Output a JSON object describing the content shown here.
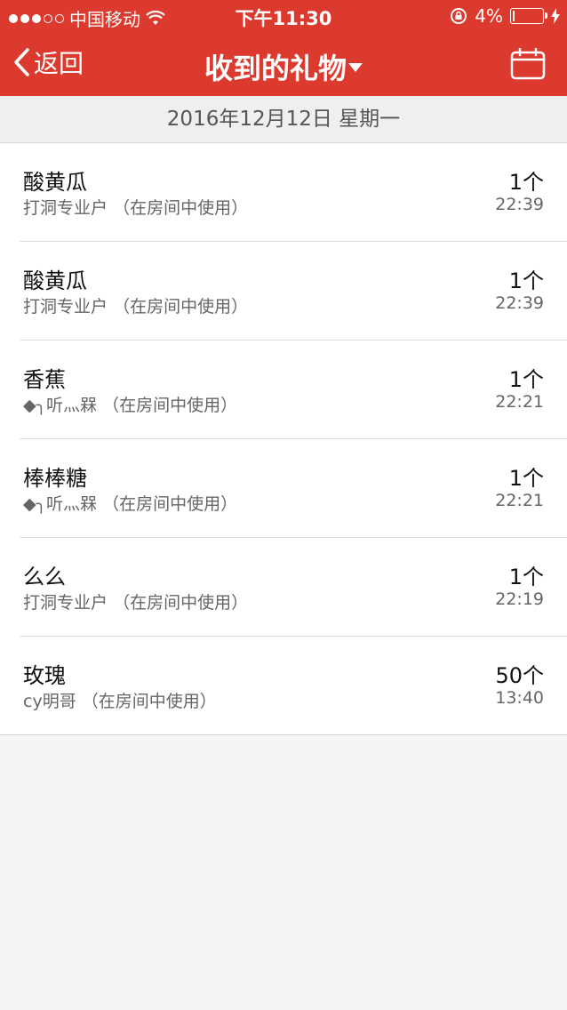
{
  "status_bar": {
    "carrier": "中国移动",
    "time": "下午11:30",
    "battery": "4%",
    "signal_bars_filled": 3,
    "signal_bars_total": 5
  },
  "nav": {
    "back_label": "返回",
    "title": "收到的礼物",
    "icons": [
      "chevron-left-icon",
      "caret-down-icon",
      "calendar-icon"
    ]
  },
  "date_header": "2016年12月12日 星期一",
  "gifts": [
    {
      "name": "酸黄瓜",
      "sender": "打洞专业户",
      "note": "（在房间中使用）",
      "count": "1个",
      "time": "22:39"
    },
    {
      "name": "酸黄瓜",
      "sender": "打洞专业户",
      "note": "（在房间中使用）",
      "count": "1个",
      "time": "22:39"
    },
    {
      "name": "香蕉",
      "sender": "◆╮听灬槑",
      "note": "（在房间中使用）",
      "count": "1个",
      "time": "22:21"
    },
    {
      "name": "棒棒糖",
      "sender": "◆╮听灬槑",
      "note": "（在房间中使用）",
      "count": "1个",
      "time": "22:21"
    },
    {
      "name": "么么",
      "sender": "打洞专业户",
      "note": "（在房间中使用）",
      "count": "1个",
      "time": "22:19"
    },
    {
      "name": "玫瑰",
      "sender": "cy明哥",
      "note": "（在房间中使用）",
      "count": "50个",
      "time": "13:40"
    }
  ],
  "colors": {
    "accent": "#dc3a2e",
    "background": "#f4f4f4"
  }
}
